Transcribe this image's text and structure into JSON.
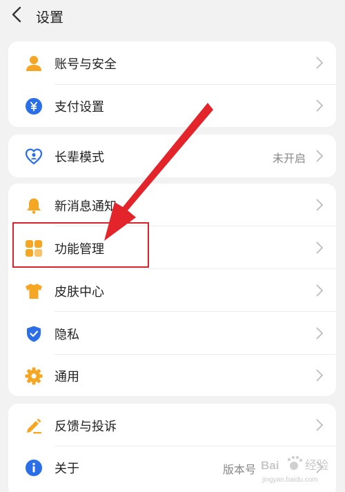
{
  "header": {
    "title": "设置"
  },
  "groups": [
    {
      "items": [
        {
          "label": "账号与安全",
          "icon": "user-icon",
          "color": "#f5a623"
        },
        {
          "label": "支付设置",
          "icon": "yuan-icon",
          "color": "#2a6ee8"
        }
      ]
    },
    {
      "items": [
        {
          "label": "长辈模式",
          "value": "未开启",
          "icon": "heart-user-icon",
          "color": "#2a6ee8"
        }
      ]
    },
    {
      "items": [
        {
          "label": "新消息通知",
          "icon": "bell-icon",
          "color": "#f5a623"
        },
        {
          "label": "功能管理",
          "icon": "grid-icon",
          "color": "#f5a623"
        },
        {
          "label": "皮肤中心",
          "icon": "tshirt-icon",
          "color": "#f5a623"
        },
        {
          "label": "隐私",
          "icon": "shield-check-icon",
          "color": "#2a6ee8"
        },
        {
          "label": "通用",
          "icon": "gear-icon",
          "color": "#f5a623"
        }
      ]
    },
    {
      "items": [
        {
          "label": "反馈与投诉",
          "icon": "pencil-icon",
          "color": "#f5a623"
        },
        {
          "label": "关于",
          "value": "版本号",
          "icon": "info-icon",
          "color": "#2a6ee8"
        }
      ]
    }
  ],
  "annotation": {
    "highlight_color": "#d9212b",
    "arrow_color": "#e3242b"
  },
  "watermark": {
    "brand": "Bai",
    "suffix": "经验",
    "url": "jingyan.baidu.com"
  }
}
